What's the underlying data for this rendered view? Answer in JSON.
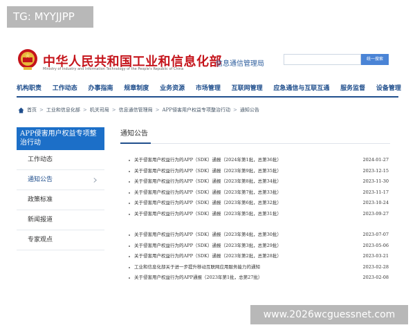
{
  "overlay": {
    "tag": "TG: MYYJJPP",
    "url": "www.2026wcguessnet.com"
  },
  "header": {
    "ministry_cn": "中华人民共和国工业和信息化部",
    "ministry_en": "Ministry of Industry and Information Technology of the People's Republic of China",
    "site_name": "信息通信管理局",
    "search_button": "统一搜索"
  },
  "nav": {
    "items": [
      {
        "label": "机构职责"
      },
      {
        "label": "工作动态"
      },
      {
        "label": "办事指南"
      },
      {
        "label": "规章制度"
      },
      {
        "label": "业务资源"
      },
      {
        "label": "市场管理"
      },
      {
        "label": "互联网管理"
      },
      {
        "label": "应急通信与互联互通"
      },
      {
        "label": "服务监督"
      },
      {
        "label": "设备管理"
      }
    ]
  },
  "breadcrumb": {
    "items": [
      {
        "label": "首页"
      },
      {
        "label": "工业和信息化部"
      },
      {
        "label": "机关司局"
      },
      {
        "label": "信息通信管理局"
      },
      {
        "label": "APP侵害用户权益专项整治行动"
      },
      {
        "label": "通知公告"
      }
    ]
  },
  "sidebar": {
    "banner": "APP侵害用户权益专项整治行动",
    "items": [
      {
        "label": "工作动态"
      },
      {
        "label": "通知公告"
      },
      {
        "label": "政策标准"
      },
      {
        "label": "新闻报道"
      },
      {
        "label": "专家观点"
      }
    ]
  },
  "content": {
    "title": "通知公告",
    "group1": [
      {
        "title": "关于侵害用户权益行为的APP（SDK）通报（2024年第1批，总第36批）",
        "date": "2024-01-27"
      },
      {
        "title": "关于侵害用户权益行为的APP（SDK）通报（2023年第9批，总第35批）",
        "date": "2023-12-15"
      },
      {
        "title": "关于侵害用户权益行为的APP（SDK）通报（2023年第8批，总第34批）",
        "date": "2023-11-30"
      },
      {
        "title": "关于侵害用户权益行为的APP（SDK）通报（2023年第7批，总第33批）",
        "date": "2023-11-17"
      },
      {
        "title": "关于侵害用户权益行为的APP（SDK）通报（2023年第6批，总第32批）",
        "date": "2023-10-24"
      },
      {
        "title": "关于侵害用户权益行为的APP（SDK）通报（2023年第5批，总第31批）",
        "date": "2023-09-27"
      }
    ],
    "group2": [
      {
        "title": "关于侵害用户权益行为的APP（SDK）通报（2023年第4批，总第30批）",
        "date": "2023-07-07"
      },
      {
        "title": "关于侵害用户权益行为的APP（SDK）通报（2023年第3批，总第29批）",
        "date": "2023-05-06"
      },
      {
        "title": "关于侵害用户权益行为的APP（SDK）通报（2023年第2批，总第28批）",
        "date": "2023-03-21"
      },
      {
        "title": "工业和信息化部关于进一步提升移动互联网应用服务能力的通知",
        "date": "2023-02-28"
      },
      {
        "title": "关于侵害用户权益行为的APP通报（2023年第1批，总第27批）",
        "date": "2023-02-08"
      }
    ]
  },
  "colors": {
    "brand_red": "#c5141b",
    "nav_blue": "#1f4e8c",
    "banner_blue": "#1c6fc8",
    "search_blue": "#4a84d6"
  }
}
